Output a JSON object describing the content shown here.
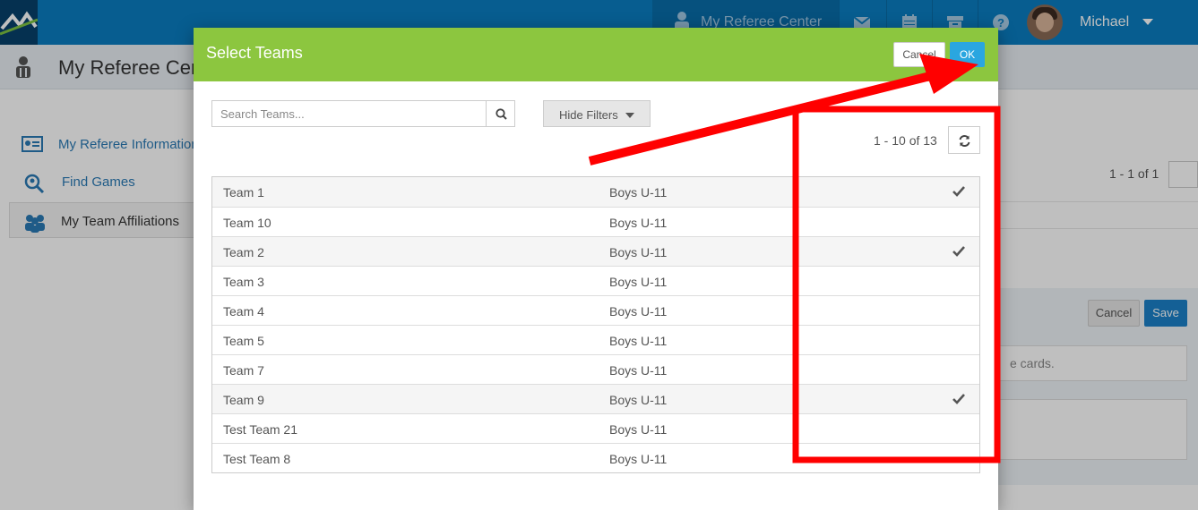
{
  "topbar": {
    "nav_label": "My Referee Center",
    "user_name": "Michael",
    "icons": [
      "envelope-icon",
      "calendar-icon",
      "archive-icon",
      "help-icon"
    ]
  },
  "page": {
    "title": "My Referee Center"
  },
  "sidebar": {
    "items": [
      {
        "label": "My Referee Information",
        "icon": "id-card-icon"
      },
      {
        "label": "Find Games",
        "icon": "search-people-icon"
      },
      {
        "label": "My Team Affiliations",
        "icon": "team-icon"
      }
    ]
  },
  "background_panel": {
    "count": "1 - 1 of 1",
    "cancel_label": "Cancel",
    "save_label": "Save",
    "cards_text": "e cards."
  },
  "modal": {
    "title": "Select Teams",
    "cancel_label": "Cancel",
    "ok_label": "OK",
    "search_placeholder": "Search Teams...",
    "search_value": "",
    "filters_label": "Hide Filters",
    "pager_count": "1 - 10 of 13",
    "colors": {
      "header": "#8cc63f",
      "ok": "#2aa6e0",
      "annotation": "#ff0000"
    },
    "teams": [
      {
        "name": "Team 1",
        "division": "Boys U-11",
        "selected": true
      },
      {
        "name": "Team 10",
        "division": "Boys U-11",
        "selected": false
      },
      {
        "name": "Team 2",
        "division": "Boys U-11",
        "selected": true
      },
      {
        "name": "Team 3",
        "division": "Boys U-11",
        "selected": false
      },
      {
        "name": "Team 4",
        "division": "Boys U-11",
        "selected": false
      },
      {
        "name": "Team 5",
        "division": "Boys U-11",
        "selected": false
      },
      {
        "name": "Team 7",
        "division": "Boys U-11",
        "selected": false
      },
      {
        "name": "Team 9",
        "division": "Boys U-11",
        "selected": true
      },
      {
        "name": "Test Team 21",
        "division": "Boys U-11",
        "selected": false
      },
      {
        "name": "Test Team 8",
        "division": "Boys U-11",
        "selected": false
      }
    ]
  }
}
